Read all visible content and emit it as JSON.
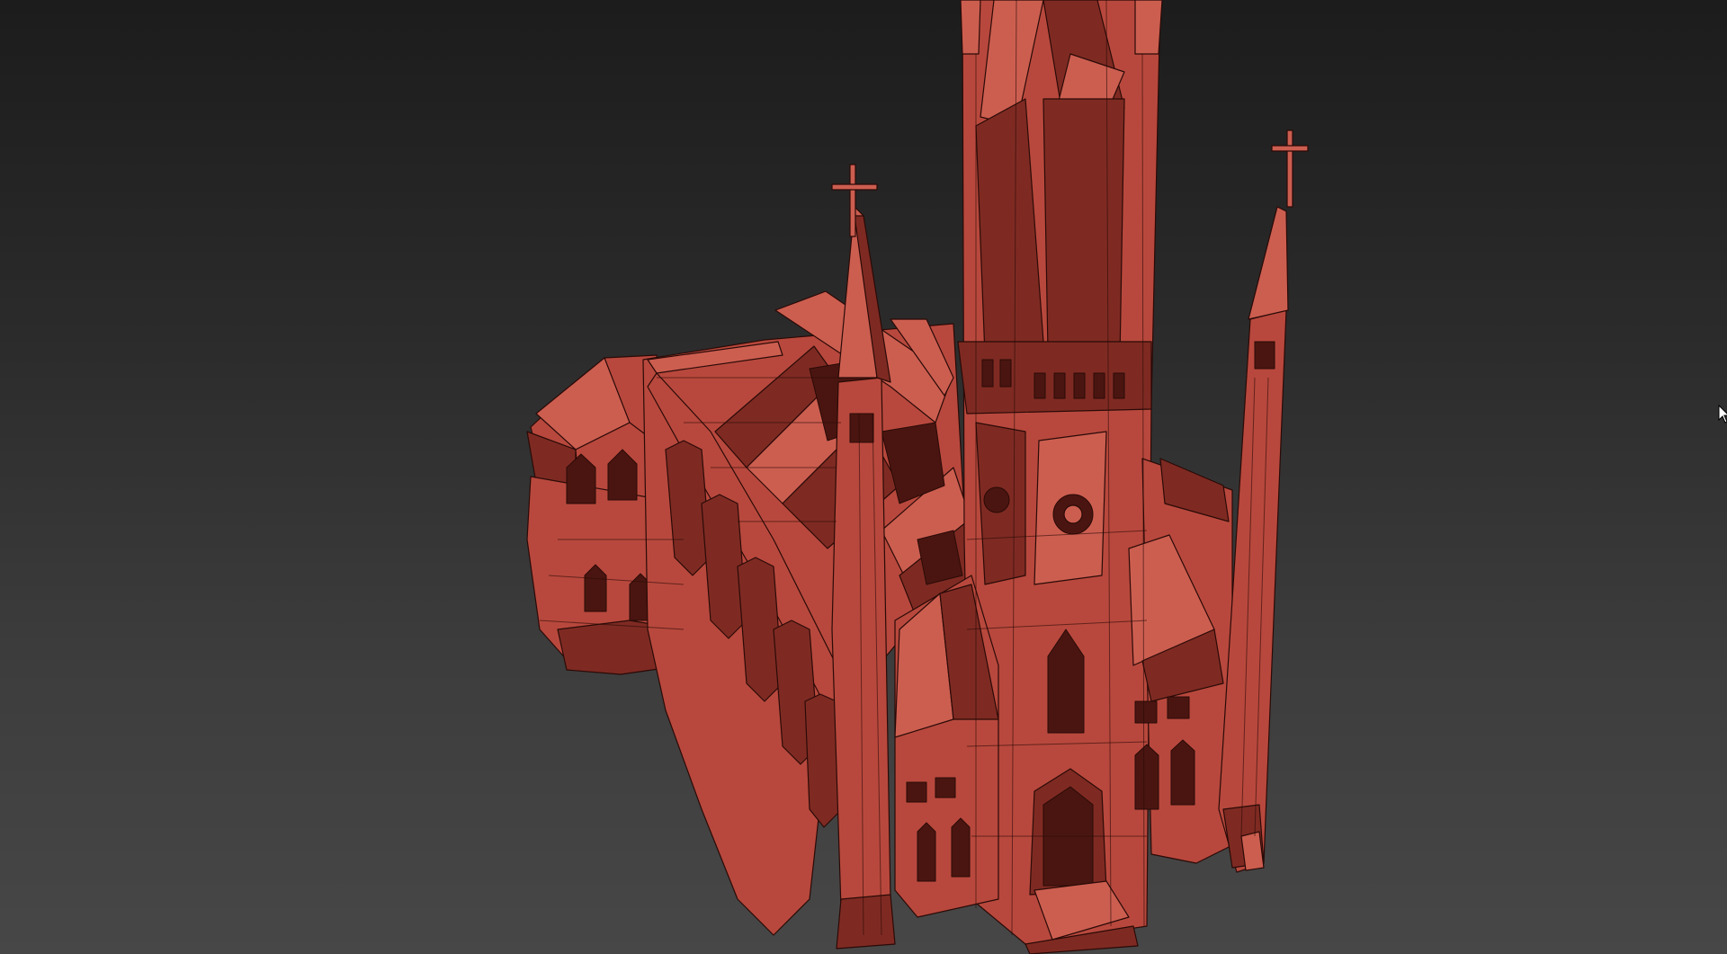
{
  "viewport": {
    "background_top": "#1c1c1c",
    "background_bottom": "#474747"
  },
  "model": {
    "fill": "#b8483d",
    "fill_light": "#cc5e50",
    "fill_dark": "#7e2a22",
    "wire": "#2a0a07"
  },
  "icons": {
    "cursor": "arrow-cursor-icon"
  }
}
